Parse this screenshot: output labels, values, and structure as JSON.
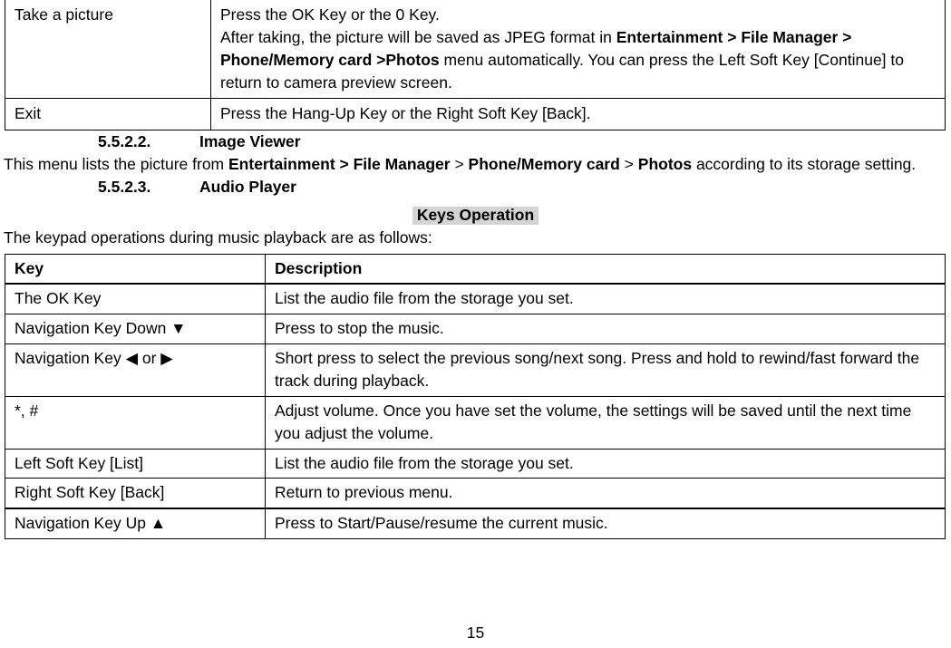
{
  "document": {
    "page_number": "15"
  },
  "camera_table": {
    "rows": [
      {
        "key": "Take a picture",
        "description_lines": [
          {
            "parts": [
              {
                "text": "Press the OK Key or the 0 Key.",
                "bold": false
              }
            ]
          },
          {
            "parts": [
              {
                "text": "After taking, the picture will be saved as JPEG format in ",
                "bold": false
              },
              {
                "text": "Entertainment > File Manager > Phone/Memory card >Photos",
                "bold": true
              },
              {
                "text": " menu automatically. You can press the Left Soft Key [Continue] to return to camera preview screen.",
                "bold": false
              }
            ]
          }
        ]
      },
      {
        "key": "Exit",
        "description_lines": [
          {
            "parts": [
              {
                "text": "Press the Hang-Up Key or the Right Soft Key [Back].",
                "bold": false
              }
            ]
          }
        ]
      }
    ]
  },
  "sections": [
    {
      "number": "5.5.2.2.",
      "title": "Image Viewer",
      "paragraph_parts": [
        {
          "text": "This menu lists the picture from ",
          "bold": false
        },
        {
          "text": "Entertainment > File Manager",
          "bold": true
        },
        {
          "text": " > ",
          "bold": false
        },
        {
          "text": "Phone/Memory card",
          "bold": true
        },
        {
          "text": " > ",
          "bold": false
        },
        {
          "text": "Photos",
          "bold": true
        },
        {
          "text": " according to its storage setting.",
          "bold": false
        }
      ]
    },
    {
      "number": "5.5.2.3.",
      "title": "Audio Player"
    }
  ],
  "keys_operation": {
    "heading": "Keys Operation",
    "intro": "The keypad operations during music playback are as follows:",
    "columns": [
      "Key",
      "Description"
    ],
    "rows": [
      {
        "key": "The OK Key",
        "description": "List the audio file from the storage you set."
      },
      {
        "key": "Navigation Key Down ▼",
        "description": "Press to stop the music."
      },
      {
        "key": "Navigation Key  ◀  or  ▶",
        "description": "Short press to select the previous song/next song. Press and hold to rewind/fast forward the track during playback."
      },
      {
        "key": "*, #",
        "description": "Adjust volume. Once you have set the volume, the settings will be saved until the next time you adjust the volume."
      },
      {
        "key": "Left Soft Key [List]",
        "description": "List the audio file from the storage you set."
      },
      {
        "key": "Right Soft Key [Back]",
        "description": "Return to previous menu."
      },
      {
        "key": "Navigation Key Up ▲",
        "description": "Press to Start/Pause/resume the current music."
      }
    ]
  }
}
